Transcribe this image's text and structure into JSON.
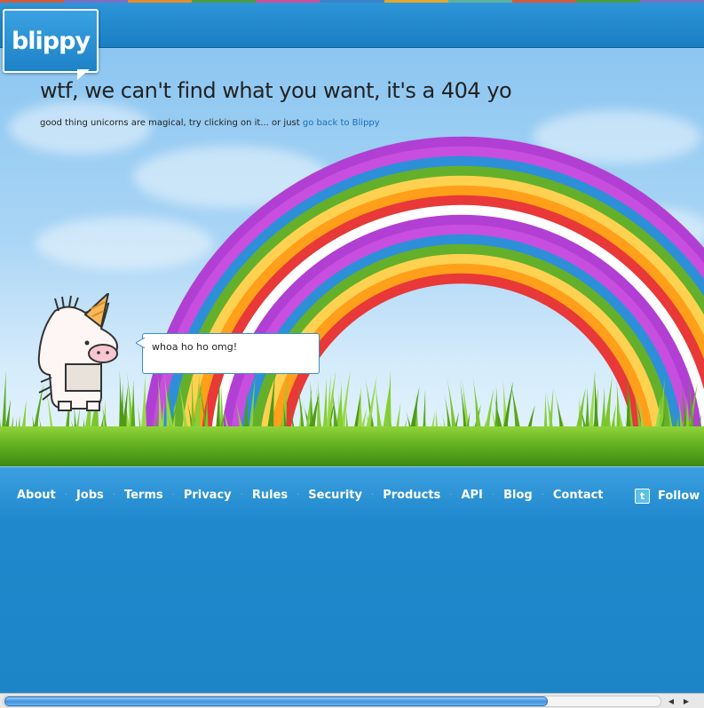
{
  "colors": {
    "brand_blue": "#1c86c9",
    "link": "#1a6fb5",
    "rainbow": [
      "#b23fd4",
      "#c84ee0",
      "#2d8fd8",
      "#64b02a",
      "#ffd150",
      "#ff9f1a",
      "#e83838",
      "#ffffff"
    ]
  },
  "logo": {
    "text": "blippy"
  },
  "main": {
    "headline": "wtf, we can't find what you want, it's a 404 yo",
    "subline_text": "good thing unicorns are magical, try clicking on it... or just ",
    "subline_link": "go back to Blippy",
    "speech_bubble": "whoa ho ho omg!",
    "unicorn_icon": "unicorn-illustration",
    "rainbow_icon": "rainbow-illustration"
  },
  "footer": {
    "nav": [
      "About",
      "Jobs",
      "Terms",
      "Privacy",
      "Rules",
      "Security",
      "Products",
      "API",
      "Blog",
      "Contact"
    ],
    "follow_label": "Follow @",
    "follow_icon": "twitter-icon"
  },
  "scrollbar": {
    "left_arrow": "◀",
    "right_arrow": "▶"
  }
}
